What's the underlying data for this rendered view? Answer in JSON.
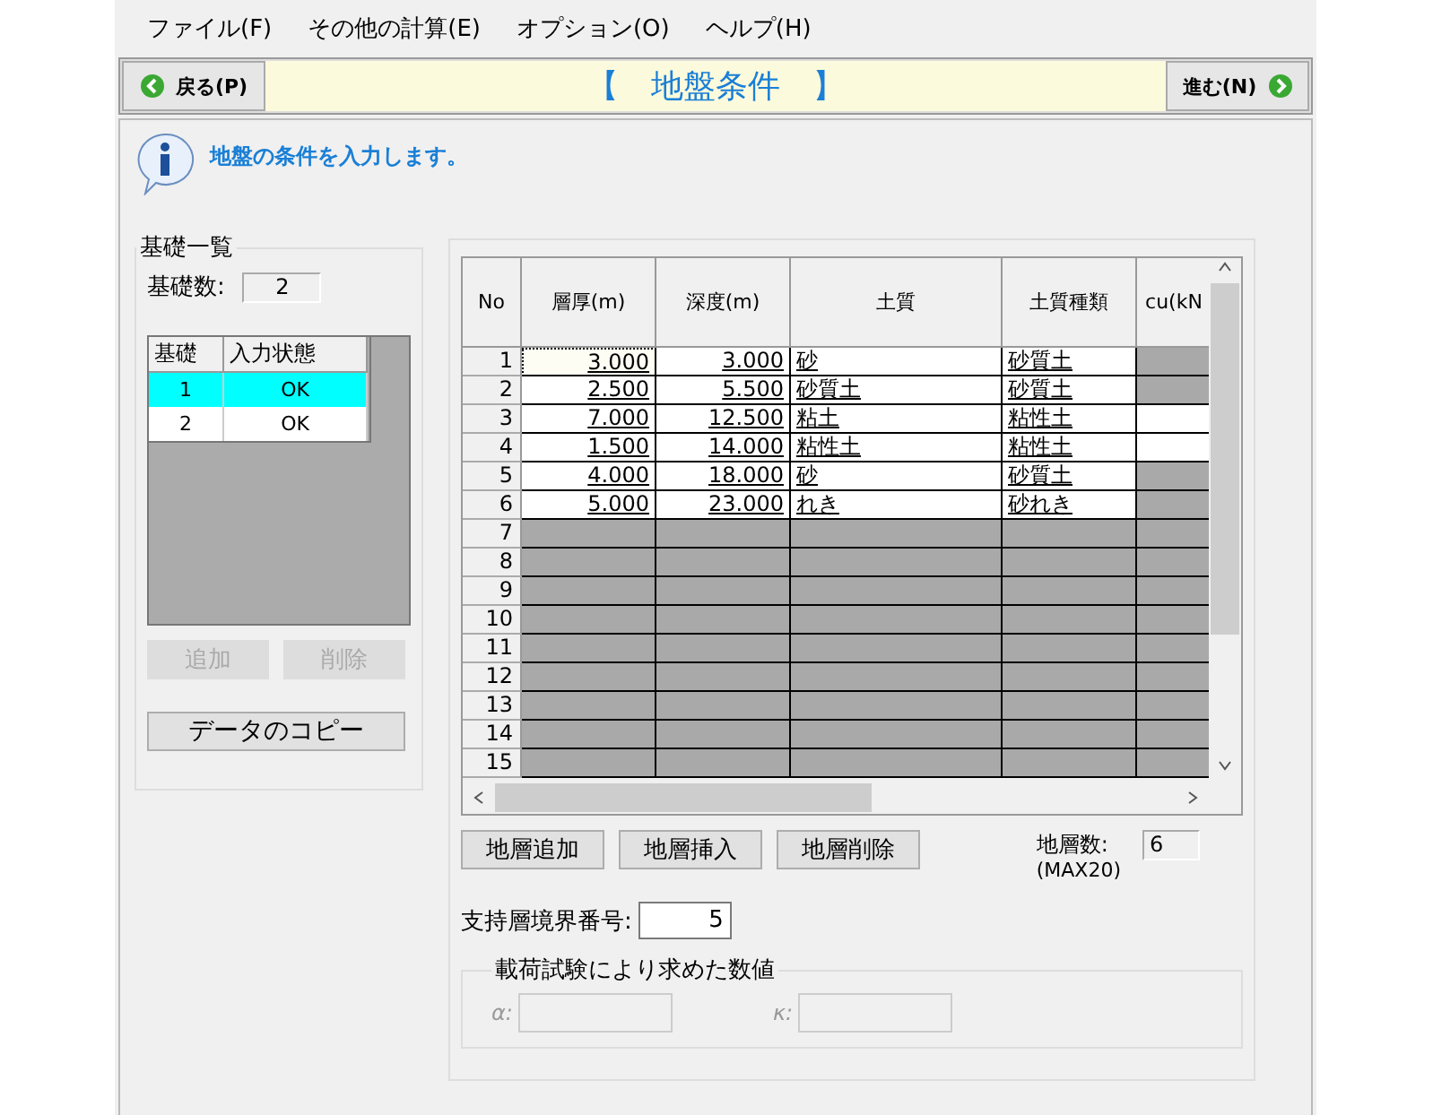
{
  "menu": [
    "ファイル(F)",
    "その他の計算(E)",
    "オプション(O)",
    "ヘルプ(H)"
  ],
  "nav": {
    "back": "戻る(P)",
    "title": "【　地盤条件　】",
    "next": "進む(N)"
  },
  "info": "地盤の条件を入力します。",
  "foundations": {
    "title": "基礎一覧",
    "count_label": "基礎数:",
    "count": "2",
    "columns": [
      "基礎",
      "入力状態"
    ],
    "rows": [
      {
        "id": "1",
        "status": "OK",
        "selected": true
      },
      {
        "id": "2",
        "status": "OK",
        "selected": false
      }
    ],
    "buttons": [
      {
        "label": "追加",
        "disabled": true
      },
      {
        "label": "削除",
        "disabled": true
      }
    ],
    "copy": "データのコピー"
  },
  "layers": {
    "columns": [
      "No",
      "層厚(m)",
      "深度(m)",
      "土質",
      "土質種類",
      "cu(kN"
    ],
    "rows": [
      {
        "no": "1",
        "thickness": "3.000",
        "depth": "3.000",
        "soil": "砂",
        "soil_type": "砂質土",
        "enabled": true,
        "cu_enabled": false,
        "focused": true
      },
      {
        "no": "2",
        "thickness": "2.500",
        "depth": "5.500",
        "soil": "砂質土",
        "soil_type": "砂質土",
        "enabled": true,
        "cu_enabled": false,
        "focused": false
      },
      {
        "no": "3",
        "thickness": "7.000",
        "depth": "12.500",
        "soil": "粘土",
        "soil_type": "粘性土",
        "enabled": true,
        "cu_enabled": true,
        "focused": false
      },
      {
        "no": "4",
        "thickness": "1.500",
        "depth": "14.000",
        "soil": "粘性土",
        "soil_type": "粘性土",
        "enabled": true,
        "cu_enabled": true,
        "focused": false
      },
      {
        "no": "5",
        "thickness": "4.000",
        "depth": "18.000",
        "soil": "砂",
        "soil_type": "砂質土",
        "enabled": true,
        "cu_enabled": false,
        "focused": false
      },
      {
        "no": "6",
        "thickness": "5.000",
        "depth": "23.000",
        "soil": "れき",
        "soil_type": "砂れき",
        "enabled": true,
        "cu_enabled": false,
        "focused": false
      },
      {
        "no": "7",
        "enabled": false,
        "cu_enabled": false,
        "focused": false
      },
      {
        "no": "8",
        "enabled": false,
        "cu_enabled": false,
        "focused": false
      },
      {
        "no": "9",
        "enabled": false,
        "cu_enabled": false,
        "focused": false
      },
      {
        "no": "10",
        "enabled": false,
        "cu_enabled": false,
        "focused": false
      },
      {
        "no": "11",
        "enabled": false,
        "cu_enabled": false,
        "focused": false
      },
      {
        "no": "12",
        "enabled": false,
        "cu_enabled": false,
        "focused": false
      },
      {
        "no": "13",
        "enabled": false,
        "cu_enabled": false,
        "focused": false
      },
      {
        "no": "14",
        "enabled": false,
        "cu_enabled": false,
        "focused": false
      },
      {
        "no": "15",
        "enabled": false,
        "cu_enabled": false,
        "focused": false
      }
    ],
    "buttons": [
      "地層追加",
      "地層挿入",
      "地層削除"
    ],
    "count_label": "地層数:",
    "count_note": "(MAX20)",
    "count": "6"
  },
  "support": {
    "label": "支持層境界番号:",
    "value": "5"
  },
  "load_test": {
    "title": "載荷試験により求めた数値",
    "alpha_label": "α:",
    "kappa_label": "κ:"
  }
}
